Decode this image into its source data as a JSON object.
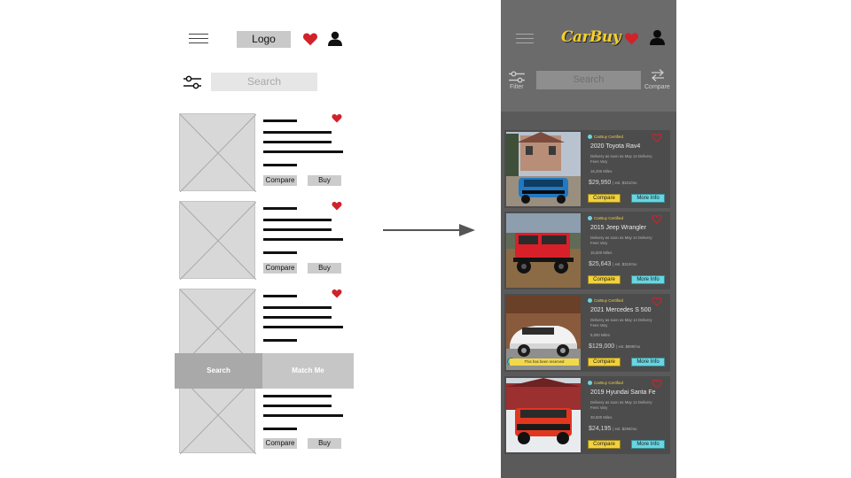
{
  "wireframe": {
    "logo": "Logo",
    "search_placeholder": "Search",
    "cards": [
      {
        "compare": "Compare",
        "buy": "Buy"
      },
      {
        "compare": "Compare",
        "buy": "Buy"
      },
      {
        "compare": "",
        "buy": ""
      },
      {
        "compare": "Compare",
        "buy": "Buy"
      }
    ],
    "bottom_tabs": {
      "search": "Search",
      "match": "Match Me"
    },
    "colors": {
      "heart": "#d0222b",
      "placeholder": "#d8d8d8"
    }
  },
  "mockup": {
    "brand": "CarBuy",
    "filter_label": "Filter",
    "search_placeholder": "Search",
    "compare_label": "Compare",
    "colors": {
      "accent_yellow": "#f2d13a",
      "accent_cyan": "#68d6e2",
      "heart": "#d0222b",
      "background": "#5a5a5a"
    },
    "listings": [
      {
        "certified": "CarBuy Certified",
        "title": "2020 Toyota Rav4",
        "delivery": "Delivery as soon as May 14 Delivery Fees Vary",
        "miles": "16,200 Miles",
        "price": "$29,950",
        "estimate": "| est. $321/mo",
        "compare": "Compare",
        "more": "More Info",
        "reserved": ""
      },
      {
        "certified": "CarBuy Certified",
        "title": "2015 Jeep Wrangler",
        "delivery": "Delivery as soon as May 14 Delivery Fees Vary",
        "miles": "15,500 Miles",
        "price": "$25,643",
        "estimate": "| est. $310/mo",
        "compare": "Compare",
        "more": "More Info",
        "reserved": ""
      },
      {
        "certified": "CarBuy Certified",
        "title": "2021 Mercedes S 500",
        "delivery": "Delivery as soon as May 14 Delivery Fees Vary",
        "miles": "5,000 Miles",
        "price": "$129,000",
        "estimate": "| est. $889/mo",
        "compare": "Compare",
        "more": "More Info",
        "reserved": "This has been reserved"
      },
      {
        "certified": "CarBuy Certified",
        "title": "2019 Hyundai Santa Fe",
        "delivery": "Delivery as soon as May 14 Delivery Fees Vary",
        "miles": "30,600 Miles",
        "price": "$24,195",
        "estimate": "| est. $290/mo",
        "compare": "Compare",
        "more": "More Info",
        "reserved": ""
      }
    ]
  }
}
